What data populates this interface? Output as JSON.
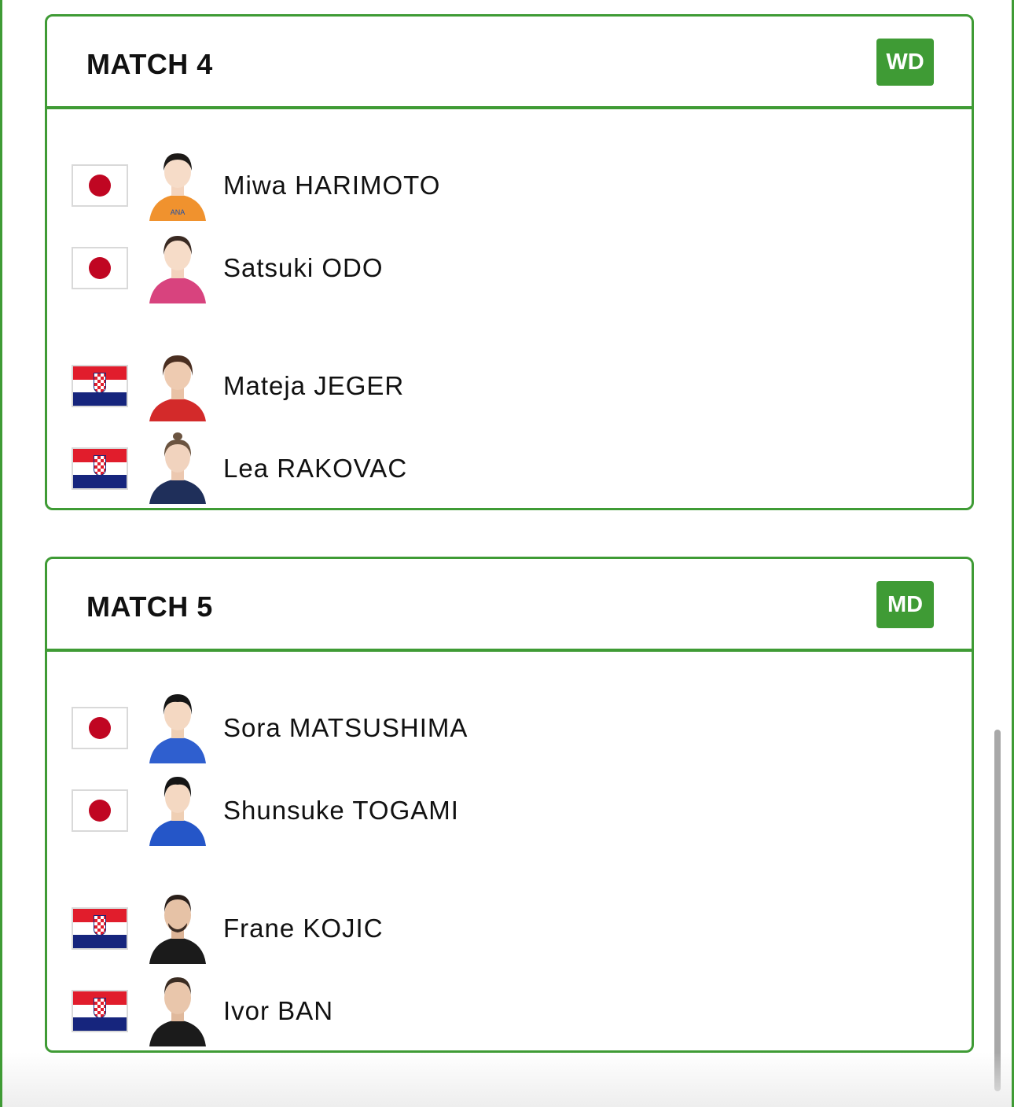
{
  "matches": [
    {
      "title": "MATCH 4",
      "badge": "WD",
      "teams": [
        {
          "players": [
            {
              "name": "Miwa HARIMOTO",
              "flag": "japan",
              "jersey_color": "#f0922e"
            },
            {
              "name": "Satsuki ODO",
              "flag": "japan",
              "jersey_color": "#d8437e"
            }
          ]
        },
        {
          "players": [
            {
              "name": "Mateja JEGER",
              "flag": "croatia",
              "jersey_color": "#d32a2a"
            },
            {
              "name": "Lea RAKOVAC",
              "flag": "croatia",
              "jersey_color": "#1f2f5a"
            }
          ]
        }
      ]
    },
    {
      "title": "MATCH 5",
      "badge": "MD",
      "teams": [
        {
          "players": [
            {
              "name": "Sora MATSUSHIMA",
              "flag": "japan",
              "jersey_color": "#2f5fcf"
            },
            {
              "name": "Shunsuke TOGAMI",
              "flag": "japan",
              "jersey_color": "#2556c8"
            }
          ]
        },
        {
          "players": [
            {
              "name": "Frane KOJIC",
              "flag": "croatia",
              "jersey_color": "#1b1b1b"
            },
            {
              "name": "Ivor BAN",
              "flag": "croatia",
              "jersey_color": "#1b1b1b"
            }
          ]
        }
      ]
    }
  ],
  "colors": {
    "accent": "#3f9b35",
    "japan_red": "#c00622",
    "croatia_red": "#e11d2c",
    "croatia_blue": "#16257d"
  }
}
